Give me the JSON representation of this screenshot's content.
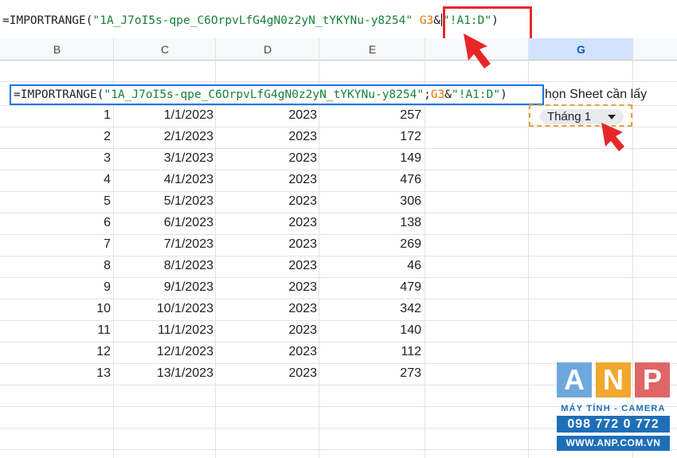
{
  "formula_bar": {
    "prefix": "=IMPORTRANGE(",
    "spreadsheet_id": "\"1A_J7oI5s-qpe_C6OrpvLfG4gN0z2yN_tYKYNu-y8254\"",
    "separator": " ",
    "ref": "G3",
    "concat": "&",
    "range": "\"!A1:D\"",
    "suffix": ")"
  },
  "columns": [
    "B",
    "C",
    "D",
    "E",
    "",
    "G"
  ],
  "editor": {
    "prefix": "=IMPORTRANGE(",
    "spreadsheet_id": "\"1A_J7oI5s-qpe_C6OrpvLfG4gN0z2yN_tYKYNu-y8254\"",
    "separator": ";",
    "ref": "G3",
    "concat": "&",
    "range": "\"!A1:D\"",
    "suffix": ")"
  },
  "sheet_picker": {
    "label": "họn Sheet cần lấy",
    "selected": "Tháng 1"
  },
  "rows": [
    [
      "1",
      "1/1/2023",
      "2023",
      "257"
    ],
    [
      "2",
      "2/1/2023",
      "2023",
      "172"
    ],
    [
      "3",
      "3/1/2023",
      "2023",
      "149"
    ],
    [
      "4",
      "4/1/2023",
      "2023",
      "476"
    ],
    [
      "5",
      "5/1/2023",
      "2023",
      "306"
    ],
    [
      "6",
      "6/1/2023",
      "2023",
      "138"
    ],
    [
      "7",
      "7/1/2023",
      "2023",
      "269"
    ],
    [
      "8",
      "8/1/2023",
      "2023",
      "46"
    ],
    [
      "9",
      "9/1/2023",
      "2023",
      "479"
    ],
    [
      "10",
      "10/1/2023",
      "2023",
      "342"
    ],
    [
      "11",
      "11/1/2023",
      "2023",
      "140"
    ],
    [
      "12",
      "12/1/2023",
      "2023",
      "112"
    ],
    [
      "13",
      "13/1/2023",
      "2023",
      "273"
    ]
  ],
  "logo": {
    "letters": [
      "A",
      "N",
      "P"
    ],
    "colors": [
      "#6fa8dc",
      "#f0a830",
      "#e06666"
    ],
    "tagline": "MÁY TÍNH - CAMERA",
    "phone": "098 772 0 772",
    "website": "WWW.ANP.COM.VN"
  },
  "annotation_colors": {
    "highlight": "#e8262a",
    "selection": "#1a73e8",
    "dropdown_border": "#e8a23a"
  }
}
